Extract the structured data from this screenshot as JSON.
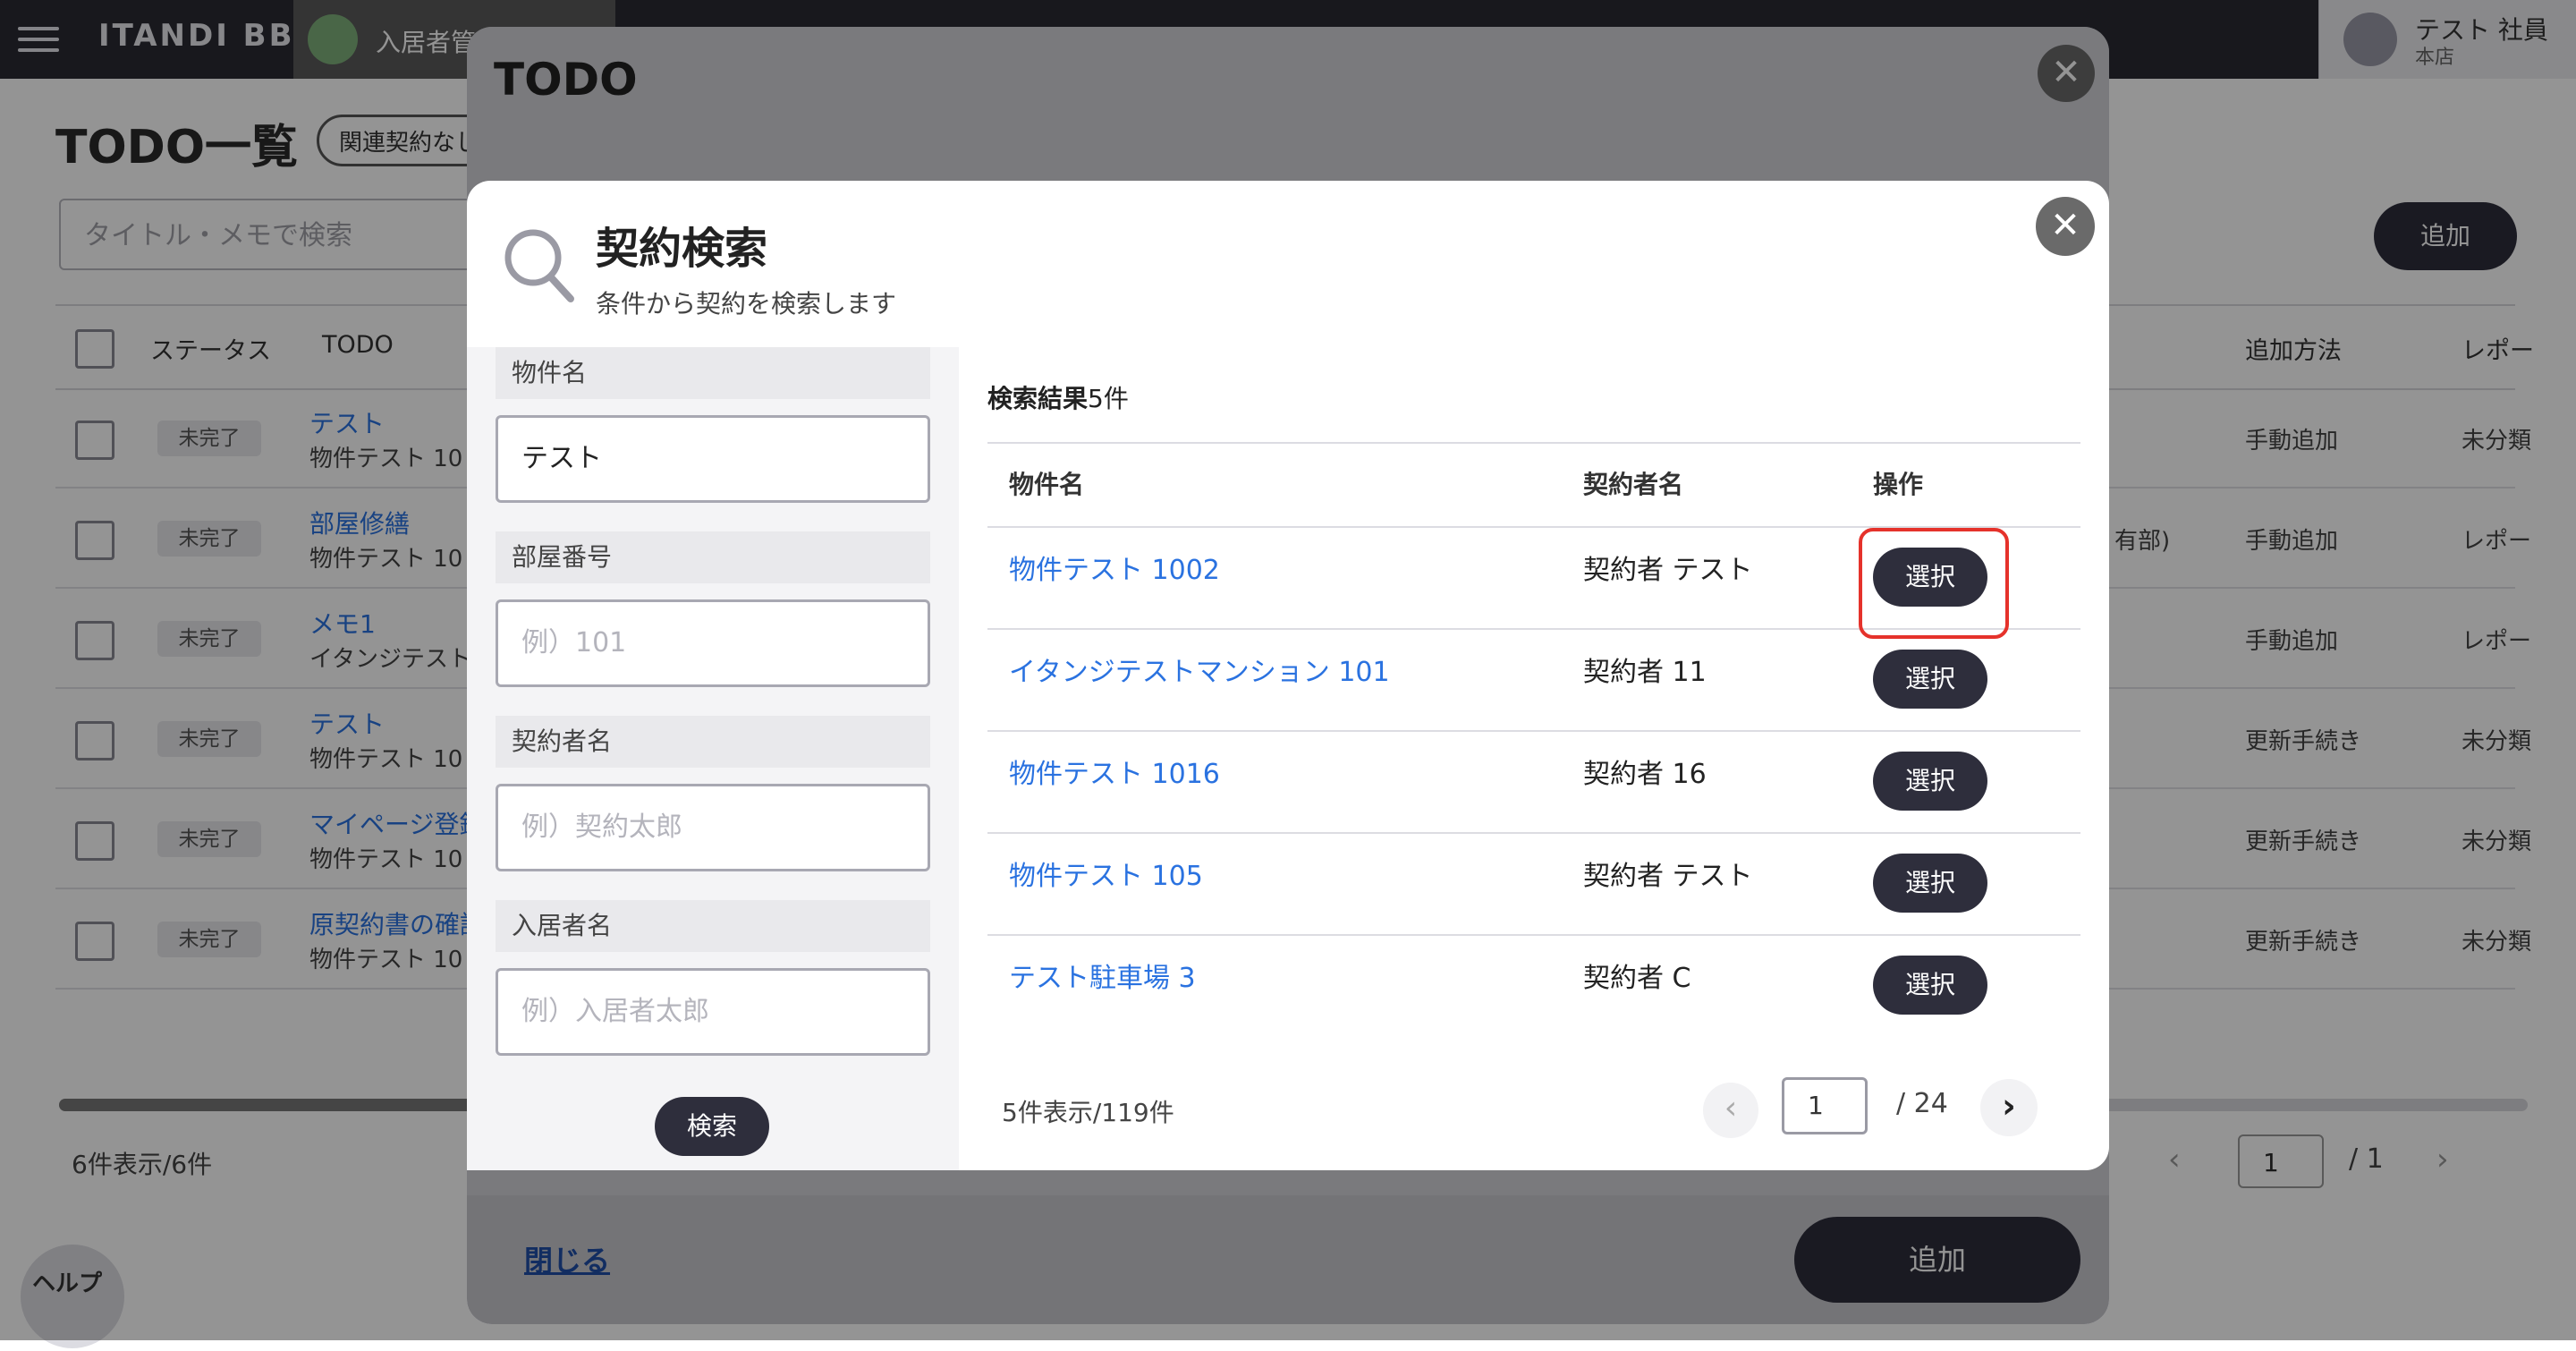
{
  "header": {
    "brand": "ITANDI BB",
    "app_label": "入居者管",
    "user_name": "テスト 社員",
    "user_branch": "本店"
  },
  "page": {
    "title": "TODO一覧",
    "filter_chip": "関連契約なし",
    "search_placeholder": "タイトル・メモで検索",
    "add_label": "追加",
    "columns": [
      "ステータス",
      "TODO",
      "追加方法",
      "レポー"
    ],
    "rows": [
      {
        "status": "未完了",
        "title": "テスト",
        "sub": "物件テスト 10",
        "method": "手動追加",
        "report": "未分類"
      },
      {
        "status": "未完了",
        "title": "部屋修繕",
        "sub": "物件テスト 10",
        "method": "手動追加",
        "report": "レポー"
      },
      {
        "status": "未完了",
        "title": "メモ1",
        "sub": "イタンジテスト",
        "method": "手動追加",
        "report": "レポー"
      },
      {
        "status": "未完了",
        "title": "テスト",
        "sub": "物件テスト 10",
        "method": "更新手続き",
        "report": "未分類"
      },
      {
        "status": "未完了",
        "title": "マイページ登録",
        "sub": "物件テスト 10",
        "method": "更新手続き",
        "report": "未分類"
      },
      {
        "status": "未完了",
        "title": "原契約書の確認",
        "sub": "物件テスト 10",
        "method": "更新手続き",
        "report": "未分類"
      }
    ],
    "row2_extra": "有部)",
    "count": "6件表示/6件",
    "pager_page": "1",
    "pager_total": "/ 1",
    "help": "ヘルプ"
  },
  "todo_dialog": {
    "title": "TODO",
    "close_link": "閉じる",
    "add_label": "追加"
  },
  "search_modal": {
    "title": "契約検索",
    "subtitle": "条件から契約を検索します",
    "fields": [
      {
        "label": "物件名",
        "value": "テスト",
        "placeholder": ""
      },
      {
        "label": "部屋番号",
        "value": "",
        "placeholder": "例）101"
      },
      {
        "label": "契約者名",
        "value": "",
        "placeholder": "例）契約太郎"
      },
      {
        "label": "入居者名",
        "value": "",
        "placeholder": "例）入居者太郎"
      }
    ],
    "search_button": "検索",
    "results_label": "検索結果",
    "results_count": "5件",
    "columns": {
      "property": "物件名",
      "contractor": "契約者名",
      "action": "操作"
    },
    "results": [
      {
        "property": "物件テスト 1002",
        "contractor": "契約者 テスト",
        "action": "選択"
      },
      {
        "property": "イタンジテストマンション 101",
        "contractor": "契約者 11",
        "action": "選択"
      },
      {
        "property": "物件テスト 1016",
        "contractor": "契約者 16",
        "action": "選択"
      },
      {
        "property": "物件テスト 105",
        "contractor": "契約者 テスト",
        "action": "選択"
      },
      {
        "property": "テスト駐車場 3",
        "contractor": "契約者 C",
        "action": "選択"
      }
    ],
    "footer_count": "5件表示/119件",
    "page_value": "1",
    "page_total": "/ 24"
  },
  "colors": {
    "link": "#2a72e0",
    "dark_button": "#2e2e3c",
    "highlight": "#e5322b"
  }
}
